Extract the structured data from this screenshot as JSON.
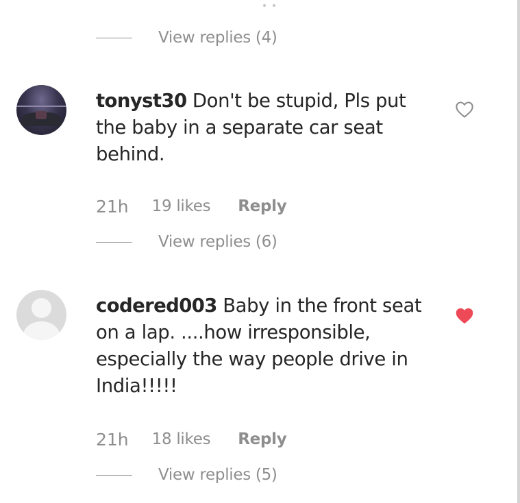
{
  "top_thread": {
    "view_replies": "View replies (4)"
  },
  "comments": [
    {
      "username": "tonyst30",
      "text": "Don't be stupid, Pls put the baby in a separate car seat behind.",
      "time": "21h",
      "likes": "19 likes",
      "reply_label": "Reply",
      "view_replies": "View replies (6)",
      "liked": false,
      "avatar_icon": "profile-photo"
    },
    {
      "username": "codered003",
      "text": "Baby in the front seat on a lap. ....how irresponsible, especially the way people drive in India!!!!!",
      "time": "21h",
      "likes": "18 likes",
      "reply_label": "Reply",
      "view_replies": "View replies (5)",
      "liked": true,
      "avatar_icon": "default-avatar-icon"
    }
  ],
  "colors": {
    "text": "#262626",
    "muted": "#8e8e8e",
    "heart_liked": "#ed4956"
  }
}
